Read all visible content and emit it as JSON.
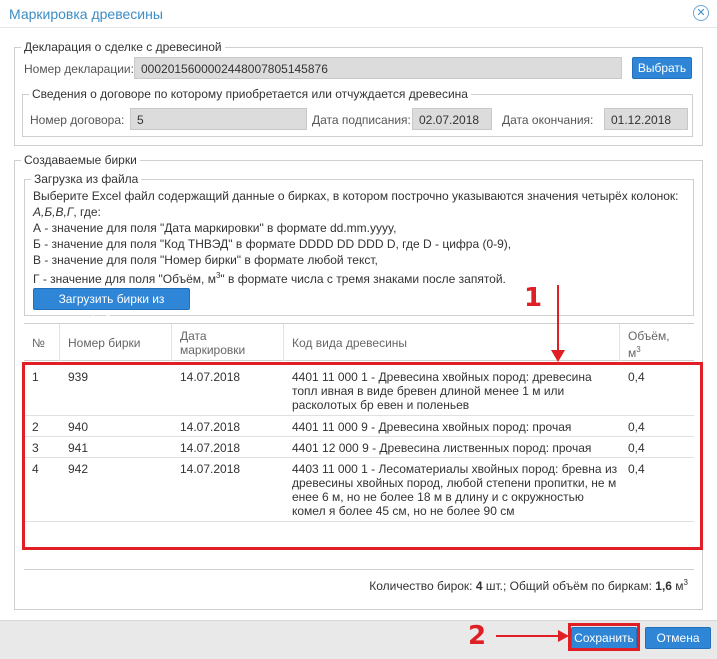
{
  "window": {
    "title": "Маркировка древесины"
  },
  "declaration": {
    "legend": "Декларация о сделке с древесиной",
    "number_label": "Номер декларации:",
    "number_value": "0002015600002448007805145876",
    "select_button": "Выбрать"
  },
  "contract": {
    "legend": "Сведения о договоре по которому приобретается или отчуждается древесина",
    "number_label": "Номер договора:",
    "number_value": "5",
    "signed_label": "Дата подписания:",
    "signed_value": "02.07.2018",
    "end_label": "Дата окончания:",
    "end_value": "01.12.2018"
  },
  "tags": {
    "legend": "Создаваемые бирки",
    "upload": {
      "legend": "Загрузка из файла",
      "line1": "Выберите Excel файл содержащий данные о бирках, в котором построчно указываются значения четырёх колонок:",
      "line2": "А,Б,В,Г",
      "line2_suffix": ", где:",
      "line3": "А - значение для поля \"Дата маркировки\" в формате dd.mm.yyyy,",
      "line4": "Б - значение для поля \"Код ТНВЭД\" в формате DDDD DD DDD D, где D - цифра (0-9),",
      "line5": "В - значение для поля \"Номер бирки\" в формате любой текст,",
      "line6_pre": "Г - значение для поля \"Объём, м",
      "line6_sup": "3",
      "line6_post": "\" в формате числа с тремя знаками после запятой.",
      "upload_button": "Загрузить бирки из файла..."
    },
    "table": {
      "headers": {
        "num": "№",
        "tag": "Номер бирки",
        "date_1": "Дата",
        "date_2": "маркировки",
        "code": "Код вида древесины",
        "volume_1": "Объём,",
        "volume_2": "м",
        "volume_sup": "3"
      },
      "rows": [
        {
          "num": "1",
          "tag": "939",
          "date": "14.07.2018",
          "code": "4401 11 000 1 - Древесина хвойных пород: древесина топл ивная в виде бревен длиной менее 1 м или расколотых бр евен и поленьев",
          "volume": "0,4"
        },
        {
          "num": "2",
          "tag": "940",
          "date": "14.07.2018",
          "code": "4401 11 000 9 - Древесина хвойных пород: прочая",
          "volume": "0,4"
        },
        {
          "num": "3",
          "tag": "941",
          "date": "14.07.2018",
          "code": "4401 12 000 9 - Древесина лиственных пород: прочая",
          "volume": "0,4"
        },
        {
          "num": "4",
          "tag": "942",
          "date": "14.07.2018",
          "code": "4403 11 000 1 - Лесоматериалы хвойных пород: бревна из древесины хвойных пород, любой степени пропитки, не м енее 6 м, но не более 18 м в длину и с окружностью комел я более 45 см, но не более 90 см",
          "volume": "0,4"
        }
      ],
      "summary_pre": "Количество бирок: ",
      "summary_count": "4",
      "summary_mid": " шт.; Общий объём по биркам: ",
      "summary_volume": "1,6",
      "summary_unit": " м",
      "summary_sup": "3"
    }
  },
  "footer": {
    "save_button": "Сохранить",
    "cancel_button": "Отмена"
  },
  "annotations": {
    "marker1": "1",
    "marker2": "2",
    "color": "#e01e25"
  }
}
